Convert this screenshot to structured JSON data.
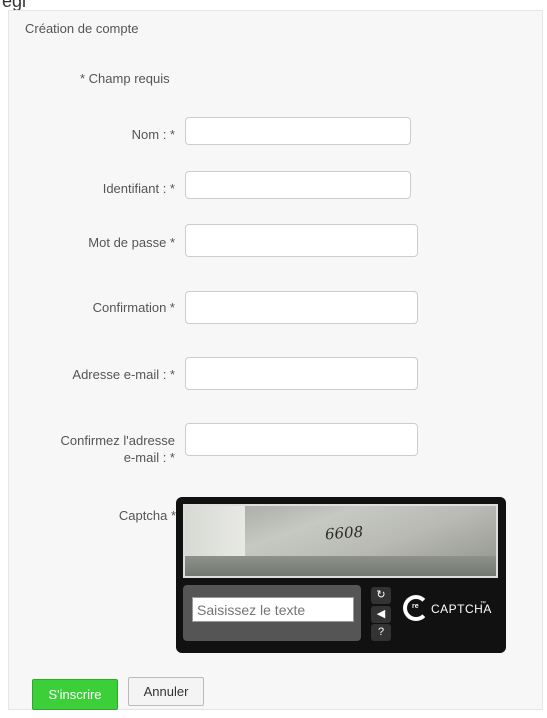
{
  "page": {
    "title": "Création de compte",
    "required_note": "* Champ requis",
    "cropped_top_text": "egi"
  },
  "fields": {
    "nom": {
      "label": "Nom : *",
      "value": ""
    },
    "identifiant": {
      "label": "Identifiant : *",
      "value": ""
    },
    "mot_de_passe": {
      "label": "Mot de passe *",
      "value": ""
    },
    "confirmation": {
      "label": "Confirmation *",
      "value": ""
    },
    "email": {
      "label": "Adresse e-mail : *",
      "value": ""
    },
    "email_confirm": {
      "label_line1": "Confirmez l'adresse",
      "label_line2": "e-mail : *",
      "value": ""
    }
  },
  "captcha": {
    "label": "Captcha *",
    "image_text": "6608",
    "input_placeholder": "Saisissez le texte",
    "logo_prefix": "re",
    "logo_text": "CAPTCHA",
    "logo_tm": "™",
    "icons": [
      "refresh-icon",
      "audio-icon",
      "help-icon"
    ]
  },
  "actions": {
    "submit_label": "S'inscrire",
    "cancel_label": "Annuler"
  },
  "colors": {
    "submit": "#3ccf3a",
    "captcha_bg": "#111111"
  }
}
